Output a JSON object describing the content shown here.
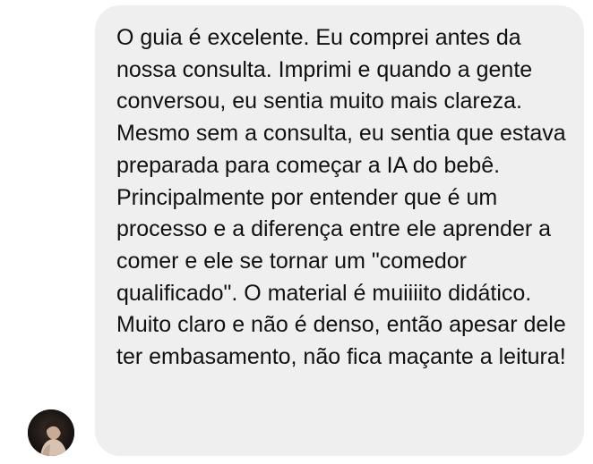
{
  "conversation": {
    "sender": {
      "avatar_icon": "profile-photo-avatar"
    },
    "message": {
      "text": "O guia é excelente. Eu comprei antes da nossa consulta. Imprimi e quando a gente conversou, eu sentia muito mais clareza. Mesmo sem a consulta, eu sentia que estava preparada para começar a IA do bebê. Principalmente por entender que é um processo e a diferença entre ele aprender a comer e ele se tornar um \"comedor qualificado\". O material é muiiiito didático. Muito claro e não é denso, então apesar dele ter embasamento, não fica maçante a leitura!",
      "bubble_color": "#efefef",
      "text_color": "#111111"
    }
  }
}
